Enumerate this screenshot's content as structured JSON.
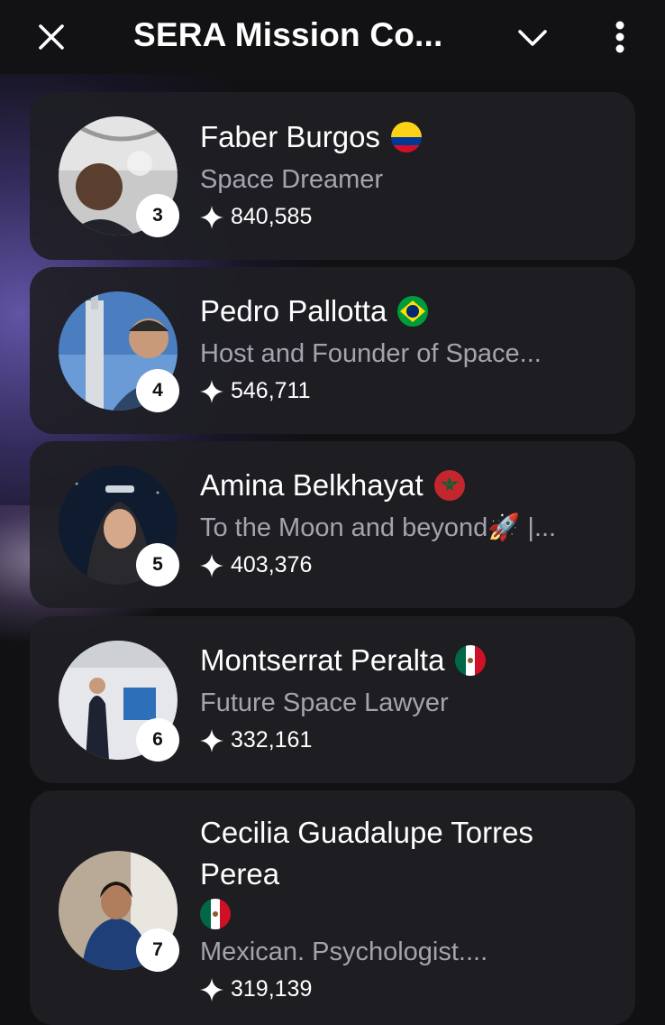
{
  "header": {
    "title": "SERA Mission Co..."
  },
  "entries": [
    {
      "rank": "3",
      "name": "Faber Burgos",
      "flag": "colombia-flag",
      "bio": "Space Dreamer",
      "score": "840,585"
    },
    {
      "rank": "4",
      "name": "Pedro Pallotta",
      "flag": "brazil-flag",
      "bio": "Host and Founder of Space...",
      "score": "546,711"
    },
    {
      "rank": "5",
      "name": "Amina Belkhayat",
      "flag": "morocco-flag",
      "bio": "To the Moon and beyond🚀 |...",
      "score": "403,376"
    },
    {
      "rank": "6",
      "name": "Montserrat Peralta",
      "flag": "mexico-flag",
      "bio": "Future Space Lawyer",
      "score": "332,161"
    },
    {
      "rank": "7",
      "name": "Cecilia Guadalupe Torres Perea",
      "flag": "mexico-flag",
      "bio": "Mexican. Psychologist....",
      "score": "319,139"
    }
  ],
  "colors": {
    "background": "#111114",
    "card": "#1e1e24",
    "secondary_text": "#a4a4ad",
    "glow": "#6e60be"
  }
}
